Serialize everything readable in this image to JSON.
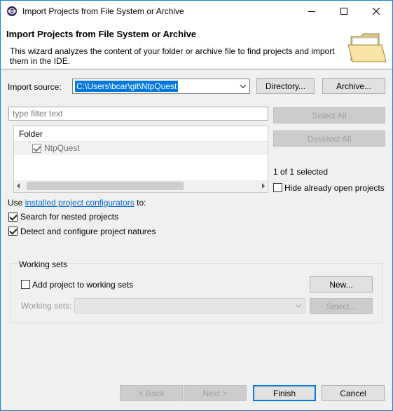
{
  "window": {
    "title": "Import Projects from File System or Archive",
    "accent": "#1883d7"
  },
  "banner": {
    "heading": "Import Projects from File System or Archive",
    "description": "This wizard analyzes the content of your folder or archive file to find projects and import them in the IDE."
  },
  "source": {
    "label": "Import source:",
    "value": "C:\\Users\\bcar\\git\\NtpQuest",
    "directory_button": "Directory...",
    "archive_button": "Archive..."
  },
  "filter": {
    "placeholder": "type filter text"
  },
  "tree": {
    "column": "Folder",
    "items": [
      {
        "name": "NtpQuest",
        "checked": true
      }
    ]
  },
  "selection": {
    "select_all": "Select All",
    "deselect_all": "Deselect All",
    "count": "1 of 1 selected",
    "hide_open": "Hide already open projects"
  },
  "options": {
    "use_prefix": "Use ",
    "configurators_link": "installed project configurators",
    "use_suffix": " to:",
    "nested": "Search for nested projects",
    "detect": "Detect and configure project natures"
  },
  "working_sets": {
    "title": "Working sets",
    "add_label": "Add project to working sets",
    "new_button": "New...",
    "sets_label": "Working sets:",
    "select_button": "Select..."
  },
  "footer": {
    "back": "< Back",
    "next": "Next >",
    "finish": "Finish",
    "cancel": "Cancel"
  }
}
